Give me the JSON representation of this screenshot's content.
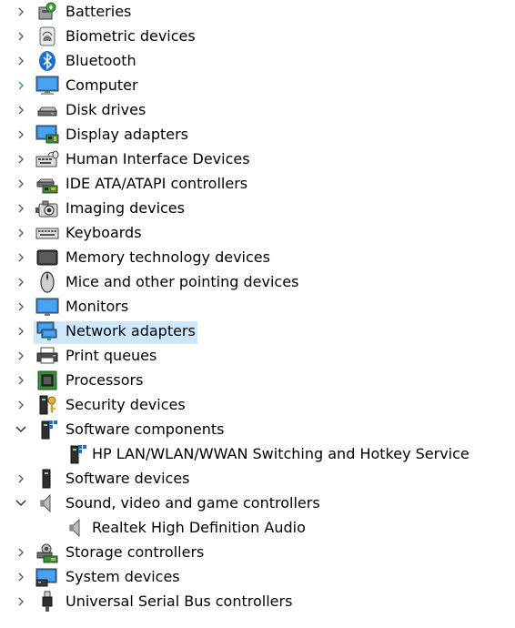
{
  "tree": {
    "nodes": [
      {
        "label": "Batteries",
        "icon": "battery-icon",
        "state": "collapsed"
      },
      {
        "label": "Biometric devices",
        "icon": "fingerprint-icon",
        "state": "collapsed"
      },
      {
        "label": "Bluetooth",
        "icon": "bluetooth-icon",
        "state": "collapsed"
      },
      {
        "label": "Computer",
        "icon": "computer-icon",
        "state": "collapsed"
      },
      {
        "label": "Disk drives",
        "icon": "disk-drive-icon",
        "state": "collapsed"
      },
      {
        "label": "Display adapters",
        "icon": "display-adapter-icon",
        "state": "collapsed"
      },
      {
        "label": "Human Interface Devices",
        "icon": "hid-icon",
        "state": "collapsed"
      },
      {
        "label": "IDE ATA/ATAPI controllers",
        "icon": "ide-controller-icon",
        "state": "collapsed"
      },
      {
        "label": "Imaging devices",
        "icon": "camera-icon",
        "state": "collapsed"
      },
      {
        "label": "Keyboards",
        "icon": "keyboard-icon",
        "state": "collapsed"
      },
      {
        "label": "Memory technology devices",
        "icon": "memory-icon",
        "state": "collapsed"
      },
      {
        "label": "Mice and other pointing devices",
        "icon": "mouse-icon",
        "state": "collapsed"
      },
      {
        "label": "Monitors",
        "icon": "monitor-icon",
        "state": "collapsed"
      },
      {
        "label": "Network adapters",
        "icon": "network-adapter-icon",
        "state": "collapsed"
      },
      {
        "label": "Print queues",
        "icon": "printer-icon",
        "state": "collapsed"
      },
      {
        "label": "Processors",
        "icon": "processor-icon",
        "state": "collapsed"
      },
      {
        "label": "Security devices",
        "icon": "security-key-icon",
        "state": "collapsed"
      },
      {
        "label": "Software components",
        "icon": "software-component-icon",
        "state": "expanded"
      },
      {
        "label": "HP LAN/WLAN/WWAN Switching and Hotkey Service",
        "icon": "software-component-icon",
        "state": "leaf"
      },
      {
        "label": "Software devices",
        "icon": "software-device-icon",
        "state": "collapsed"
      },
      {
        "label": "Sound, video and game controllers",
        "icon": "speaker-icon",
        "state": "expanded"
      },
      {
        "label": "Realtek High Definition Audio",
        "icon": "speaker-icon",
        "state": "leaf"
      },
      {
        "label": "Storage controllers",
        "icon": "storage-controller-icon",
        "state": "collapsed"
      },
      {
        "label": "System devices",
        "icon": "system-device-icon",
        "state": "collapsed"
      },
      {
        "label": "Universal Serial Bus controllers",
        "icon": "usb-icon",
        "state": "collapsed"
      }
    ],
    "selected_label": "Network adapters"
  },
  "colors": {
    "selection": "#cce8ff",
    "chevron": "#555555",
    "chevron_hover": "#1e90ff"
  }
}
